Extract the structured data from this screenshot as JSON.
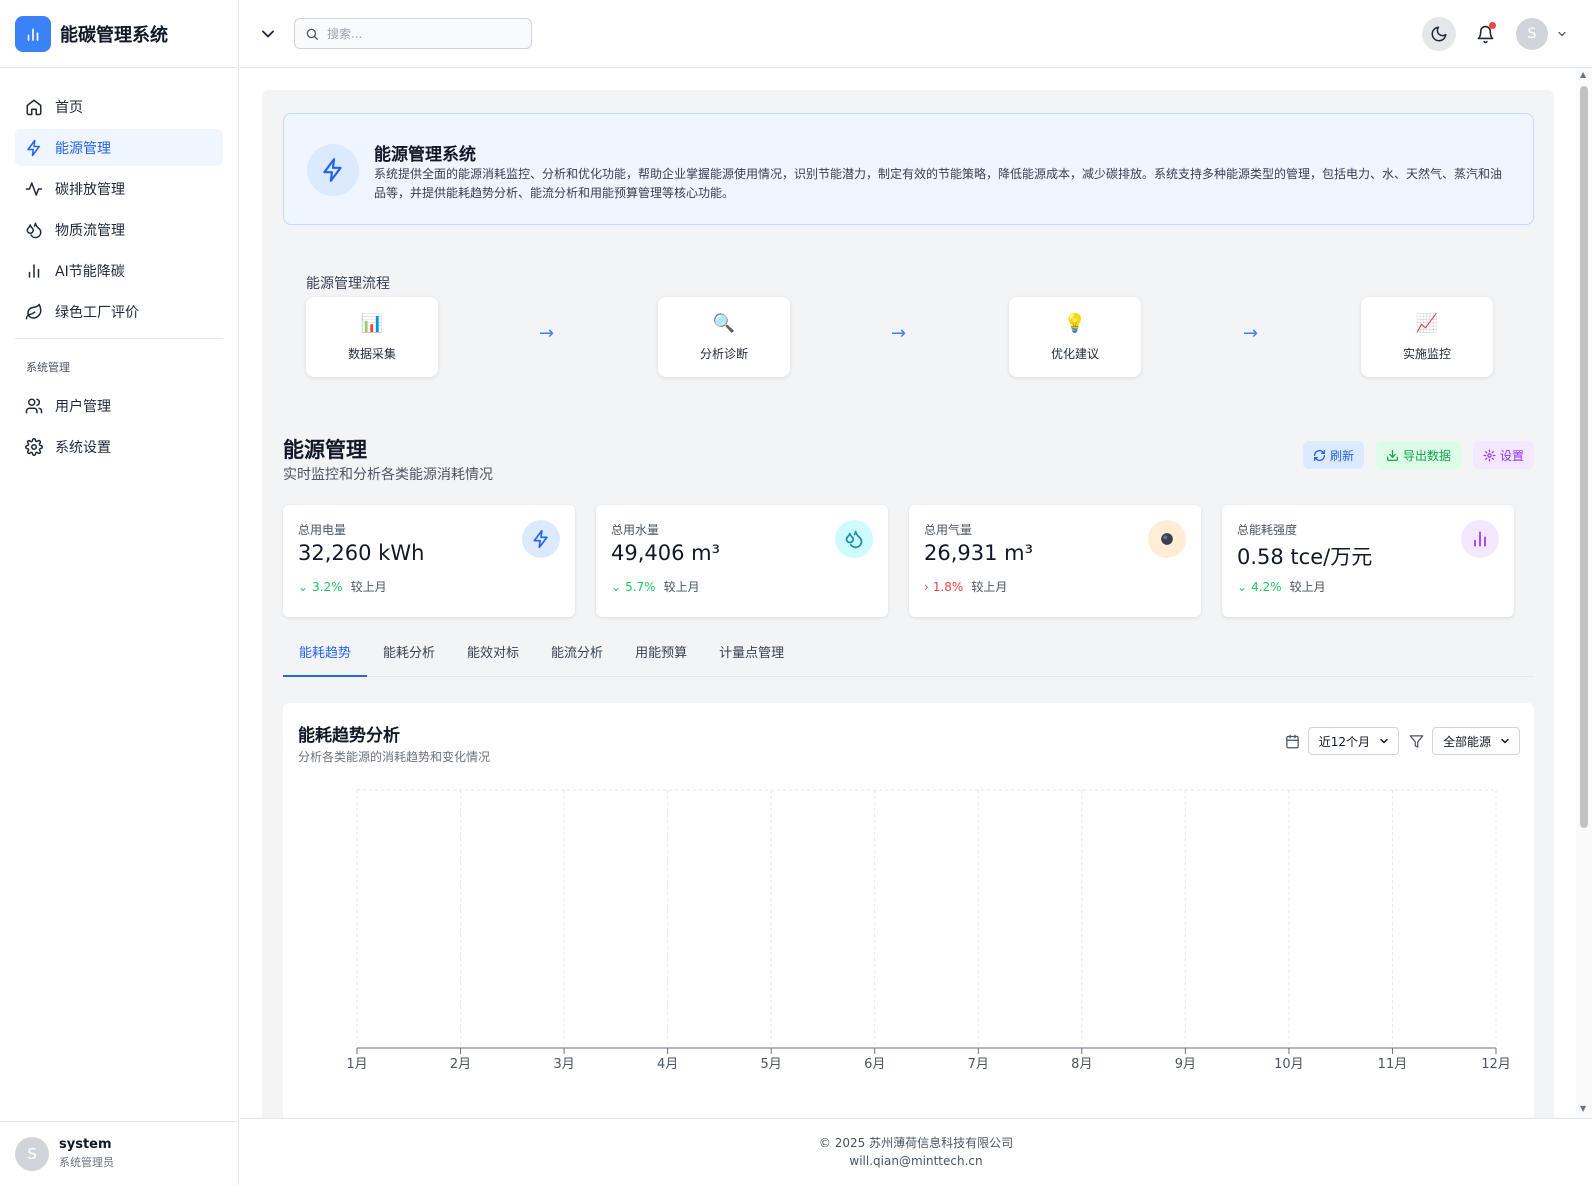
{
  "app": {
    "title": "能碳管理系统"
  },
  "sidebar": {
    "items": [
      {
        "label": "首页",
        "icon": "home-icon"
      },
      {
        "label": "能源管理",
        "icon": "bolt-icon",
        "active": true
      },
      {
        "label": "碳排放管理",
        "icon": "activity-icon"
      },
      {
        "label": "物质流管理",
        "icon": "droplets-icon"
      },
      {
        "label": "AI节能降碳",
        "icon": "bar-chart-icon"
      },
      {
        "label": "绿色工厂评价",
        "icon": "leaf-icon"
      }
    ],
    "section_label": "系统管理",
    "system_items": [
      {
        "label": "用户管理",
        "icon": "users-icon"
      },
      {
        "label": "系统设置",
        "icon": "gear-icon"
      }
    ],
    "user": {
      "initial": "S",
      "name": "system",
      "role": "系统管理员"
    }
  },
  "topbar": {
    "search_placeholder": "搜索...",
    "avatar_initial": "S"
  },
  "intro": {
    "title": "能源管理系统",
    "description": "系统提供全面的能源消耗监控、分析和优化功能，帮助企业掌握能源使用情况，识别节能潜力，制定有效的节能策略，降低能源成本，减少碳排放。系统支持多种能源类型的管理，包括电力、水、天然气、蒸汽和油品等，并提供能耗趋势分析、能流分析和用能预算管理等核心功能。"
  },
  "flow": {
    "title": "能源管理流程",
    "steps": [
      {
        "icon": "📊",
        "label": "数据采集"
      },
      {
        "icon": "🔍",
        "label": "分析诊断"
      },
      {
        "icon": "💡",
        "label": "优化建议"
      },
      {
        "icon": "📈",
        "label": "实施监控"
      }
    ],
    "arrow": "→"
  },
  "section": {
    "title": "能源管理",
    "subtitle": "实时监控和分析各类能源消耗情况",
    "refresh_label": "刷新",
    "export_label": "导出数据",
    "settings_label": "设置"
  },
  "stats": [
    {
      "label": "总用电量",
      "value": "32,260 kWh",
      "change": "3.2%",
      "trend": "down",
      "compare": "较上月",
      "icon": "bolt-icon",
      "color": "#2563eb",
      "bg": "#dbeafe"
    },
    {
      "label": "总用水量",
      "value": "49,406 m³",
      "change": "5.7%",
      "trend": "down",
      "compare": "较上月",
      "icon": "droplets-icon",
      "color": "#0891b2",
      "bg": "#cffafe"
    },
    {
      "label": "总用气量",
      "value": "26,931 m³",
      "change": "1.8%",
      "trend": "up",
      "compare": "较上月",
      "icon": "gas-icon",
      "color": "#1f2937",
      "bg": "#ffedd5"
    },
    {
      "label": "总能耗强度",
      "value": "0.58 tce/万元",
      "change": "4.2%",
      "trend": "down",
      "compare": "较上月",
      "icon": "bar-chart-icon",
      "color": "#9333ea",
      "bg": "#f3e8ff"
    }
  ],
  "tabs": [
    "能耗趋势",
    "能耗分析",
    "能效对标",
    "能流分析",
    "用能预算",
    "计量点管理"
  ],
  "chart_card": {
    "title": "能耗趋势分析",
    "subtitle": "分析各类能源的消耗趋势和变化情况",
    "period_select": "近12个月",
    "energy_select": "全部能源"
  },
  "chart_data": {
    "type": "line",
    "categories": [
      "1月",
      "2月",
      "3月",
      "4月",
      "5月",
      "6月",
      "7月",
      "8月",
      "9月",
      "10月",
      "11月",
      "12月"
    ],
    "series": [],
    "grid": true
  },
  "footer": {
    "copyright": "© 2025 苏州薄荷信息科技有限公司",
    "email": "will.qian@minttech.cn"
  }
}
